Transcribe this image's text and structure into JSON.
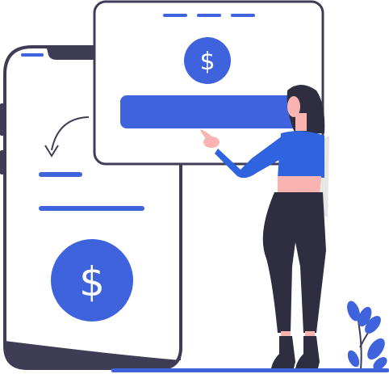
{
  "illustration": {
    "phone_currency_symbol": "$",
    "card_currency_symbol": "$",
    "icons": [
      "phone-mockup",
      "payment-card-window",
      "dollar-coin-icon",
      "curved-arrow-icon",
      "woman-figure",
      "plant-leaves"
    ]
  },
  "colors": {
    "accent": "#3e63dd",
    "accent_dark": "#2f4fcb",
    "outline": "#3f3d56",
    "figure_dark": "#2f2e41",
    "shirt": "#2f63e0",
    "skin": "#f9b3b0",
    "hair": "#2f2e41",
    "phone_bottom": "#3f3d56",
    "light_gray": "#e6e6e6"
  }
}
